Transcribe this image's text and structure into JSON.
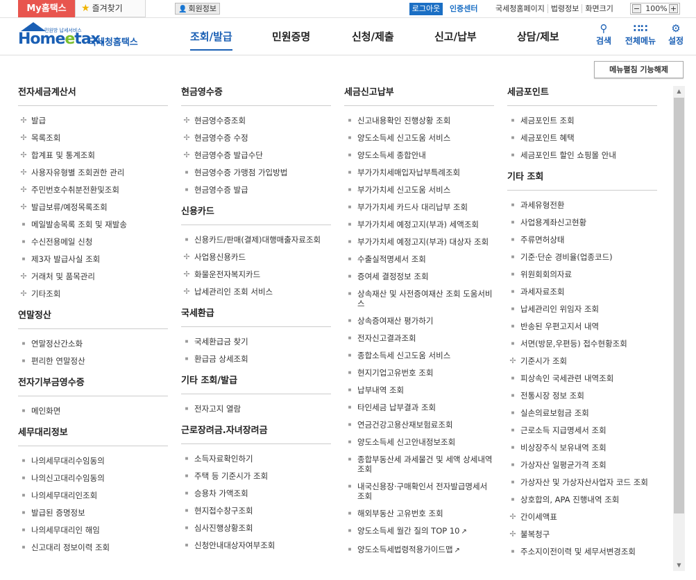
{
  "topbar": {
    "my_hometax": "My홈택스",
    "favorites": "즐겨찾기",
    "member_info": "회원정보",
    "logout": "로그아웃",
    "cert_center": "인증센터",
    "links": [
      "국세청홈페이지",
      "법령정보",
      "화면크기"
    ],
    "zoom_minus": "−",
    "zoom_value": "100%",
    "zoom_plus": "+"
  },
  "header": {
    "logo_tagline": "민원방 납세서비스",
    "logo_home": "Home",
    "logo_e": "e",
    "logo_tax": "tax.",
    "logo_kr": "국세청홈택스",
    "gnb": [
      "조회/발급",
      "민원증명",
      "신청/제출",
      "신고/납부",
      "상담/제보"
    ],
    "active_gnb": "조회/발급",
    "icons": [
      {
        "label": "검색",
        "icon": "search-icon"
      },
      {
        "label": "전체메뉴",
        "icon": "grid-menu-icon"
      },
      {
        "label": "설정",
        "icon": "gear-icon"
      }
    ]
  },
  "toggle_button": "메뉴펼침 기능해제",
  "columns": [
    [
      {
        "title": "전자세금계산서",
        "items": [
          {
            "t": "발급",
            "m": "plus"
          },
          {
            "t": "목록조회",
            "m": "plus"
          },
          {
            "t": "합계표 및 통계조회",
            "m": "plus"
          },
          {
            "t": "사용자유형별 조회권한 관리",
            "m": "plus"
          },
          {
            "t": "주민번호수취분전환및조회",
            "m": "plus"
          },
          {
            "t": "발급보류/예정목록조회",
            "m": "plus"
          },
          {
            "t": "메일발송목록 조회 및 재발송",
            "m": "dot"
          },
          {
            "t": "수신전용메일 신청",
            "m": "dot"
          },
          {
            "t": "제3자 발급사실 조회",
            "m": "dot"
          },
          {
            "t": "거래처 및 품목관리",
            "m": "plus"
          },
          {
            "t": "기타조회",
            "m": "plus"
          }
        ]
      },
      {
        "title": "연말정산",
        "items": [
          {
            "t": "연말정산간소화",
            "m": "dot"
          },
          {
            "t": "편리한 연말정산",
            "m": "dot"
          }
        ]
      },
      {
        "title": "전자기부금영수증",
        "items": [
          {
            "t": "메인화면",
            "m": "dot"
          }
        ]
      },
      {
        "title": "세무대리정보",
        "items": [
          {
            "t": "나의세무대리수임동의",
            "m": "dot"
          },
          {
            "t": "나의신고대리수임동의",
            "m": "dot"
          },
          {
            "t": "나의세무대리인조회",
            "m": "dot"
          },
          {
            "t": "발급된 증명정보",
            "m": "dot"
          },
          {
            "t": "나의세무대리인 해임",
            "m": "dot"
          },
          {
            "t": "신고대리 정보이력 조회",
            "m": "dot"
          }
        ]
      }
    ],
    [
      {
        "title": "현금영수증",
        "items": [
          {
            "t": "현금영수증조회",
            "m": "plus"
          },
          {
            "t": "현금영수증 수정",
            "m": "plus"
          },
          {
            "t": "현금영수증 발급수단",
            "m": "plus"
          },
          {
            "t": "현금영수증 가맹점 가입방법",
            "m": "dot"
          },
          {
            "t": "현금영수증 발급",
            "m": "dot"
          }
        ]
      },
      {
        "title": "신용카드",
        "items": [
          {
            "t": "신용카드/판매(결제)대행매출자료조회",
            "m": "dot"
          },
          {
            "t": "사업용신용카드",
            "m": "plus"
          },
          {
            "t": "화물운전자복지카드",
            "m": "plus"
          },
          {
            "t": "납세관리인 조회 서비스",
            "m": "plus"
          }
        ]
      },
      {
        "title": "국세환급",
        "items": [
          {
            "t": "국세환급금 찾기",
            "m": "dot"
          },
          {
            "t": "환급금 상세조회",
            "m": "dot"
          }
        ]
      },
      {
        "title": "기타 조회/발급",
        "items": [
          {
            "t": "전자고지 열람",
            "m": "dot"
          }
        ]
      },
      {
        "title": "근로장려금.자녀장려금",
        "items": [
          {
            "t": "소득자료확인하기",
            "m": "dot"
          },
          {
            "t": "주택 등 기준시가 조회",
            "m": "dot"
          },
          {
            "t": "승용차 가액조회",
            "m": "dot"
          },
          {
            "t": "현지접수창구조회",
            "m": "dot"
          },
          {
            "t": "심사진행상황조회",
            "m": "dot"
          },
          {
            "t": "신청안내대상자여부조회",
            "m": "dot"
          }
        ]
      }
    ],
    [
      {
        "title": "세금신고납부",
        "items": [
          {
            "t": "신고내용확인 진행상황 조회",
            "m": "dot"
          },
          {
            "t": "양도소득세 신고도움 서비스",
            "m": "dot"
          },
          {
            "t": "양도소득세 종합안내",
            "m": "dot"
          },
          {
            "t": "부가가치세매입자납부특례조회",
            "m": "dot"
          },
          {
            "t": "부가가치세 신고도움 서비스",
            "m": "dot"
          },
          {
            "t": "부가가치세 카드사 대리납부 조회",
            "m": "dot"
          },
          {
            "t": "부가가치세 예정고지(부과) 세액조회",
            "m": "dot"
          },
          {
            "t": "부가가치세 예정고지(부과) 대상자 조회",
            "m": "dot"
          },
          {
            "t": "수출실적명세서 조회",
            "m": "dot"
          },
          {
            "t": "증여세 결정정보 조회",
            "m": "dot"
          },
          {
            "t": "상속재산 및 사전증여재산 조회 도움서비스",
            "m": "dot"
          },
          {
            "t": "상속증여재산 평가하기",
            "m": "dot"
          },
          {
            "t": "전자신고결과조회",
            "m": "dot"
          },
          {
            "t": "종합소득세 신고도움 서비스",
            "m": "dot"
          },
          {
            "t": "현지기업고유번호 조회",
            "m": "dot"
          },
          {
            "t": "납부내역 조회",
            "m": "dot"
          },
          {
            "t": "타인세금 납부결과 조회",
            "m": "dot"
          },
          {
            "t": "연금건강고용산재보험료조회",
            "m": "dot"
          },
          {
            "t": "양도소득세 신고안내정보조회",
            "m": "dot"
          },
          {
            "t": "종합부동산세 과세물건 및 세액 상세내역 조회",
            "m": "dot"
          },
          {
            "t": "내국신용장·구매확인서 전자발급명세서 조회",
            "m": "dot"
          },
          {
            "t": "해외부동산 고유번호 조회",
            "m": "dot"
          },
          {
            "t": "양도소득세 월간 질의 TOP 10",
            "m": "dot",
            "ext": true
          },
          {
            "t": "양도소득세법령적용가이드맵",
            "m": "dot",
            "ext": true
          }
        ]
      }
    ],
    [
      {
        "title": "세금포인트",
        "items": [
          {
            "t": "세금포인트 조회",
            "m": "dot"
          },
          {
            "t": "세금포인트 혜택",
            "m": "dot"
          },
          {
            "t": "세금포인트 할인 쇼핑몰 안내",
            "m": "dot"
          }
        ]
      },
      {
        "title": "기타 조회",
        "items": [
          {
            "t": "과세유형전환",
            "m": "dot"
          },
          {
            "t": "사업용계좌신고현황",
            "m": "dot"
          },
          {
            "t": "주류면허상태",
            "m": "dot"
          },
          {
            "t": "기준·단순 경비율(업종코드)",
            "m": "dot"
          },
          {
            "t": "위원회회의자료",
            "m": "dot"
          },
          {
            "t": "과세자료조회",
            "m": "dot"
          },
          {
            "t": "납세관리인 위임자 조회",
            "m": "dot"
          },
          {
            "t": "반송된 우편고지서 내역",
            "m": "dot"
          },
          {
            "t": "서면(방문,우편등) 접수현황조회",
            "m": "dot"
          },
          {
            "t": "기준시가 조회",
            "m": "plus"
          },
          {
            "t": "피상속인 국세관련 내역조회",
            "m": "dot"
          },
          {
            "t": "전통시장 정보 조회",
            "m": "dot"
          },
          {
            "t": "실손의료보험금 조회",
            "m": "dot"
          },
          {
            "t": "근로소득 지급명세서 조회",
            "m": "dot"
          },
          {
            "t": "비상장주식 보유내역 조회",
            "m": "dot"
          },
          {
            "t": "가상자산 일평균가격 조회",
            "m": "dot"
          },
          {
            "t": "가상자산 및 가상자산사업자 코드 조회",
            "m": "dot"
          },
          {
            "t": "상호합의, APA 진행내역 조회",
            "m": "dot"
          },
          {
            "t": "간이세액표",
            "m": "plus"
          },
          {
            "t": "불복청구",
            "m": "plus"
          },
          {
            "t": "주소지이전이력 및 세무서변경조회",
            "m": "dot"
          }
        ]
      }
    ]
  ],
  "scrollbar": {
    "up": "▲",
    "down": "▼"
  }
}
